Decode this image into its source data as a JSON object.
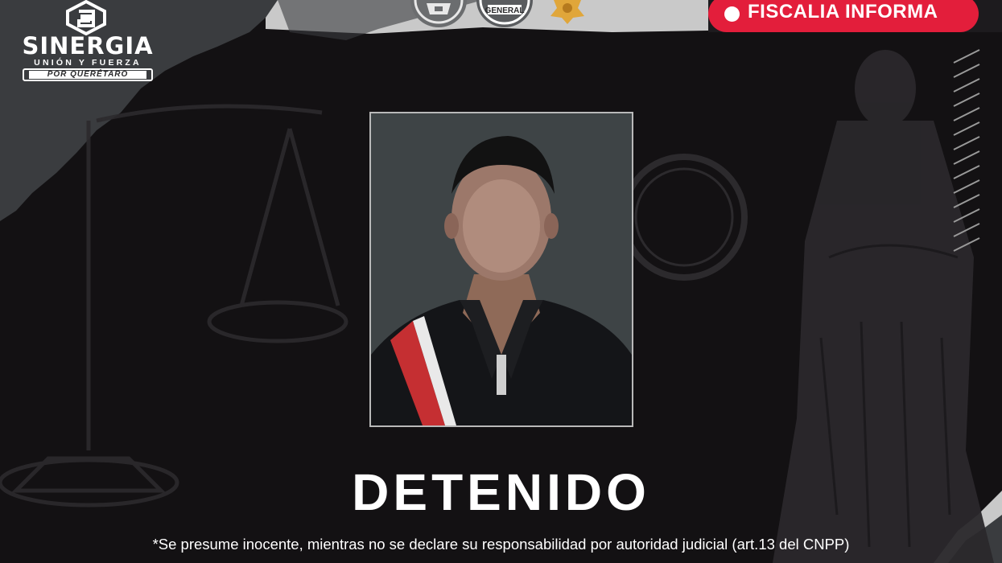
{
  "logo": {
    "name": "SINERGIA",
    "tagline": "UNIÓN Y FUERZA",
    "region": "POR QUERÉTARO"
  },
  "seals": [
    "state-seal-icon",
    "fiscalia-general-seal-icon",
    "police-star-badge-icon"
  ],
  "seal_text": "GENERAL",
  "badge": {
    "label": "FISCALIA INFORMA",
    "color": "#e31e3b"
  },
  "photo": {
    "subject": "person-photo-face-blurred"
  },
  "title": "DETENIDO",
  "disclaimer": "*Se presume inocente, mientras no se declare su responsabilidad por autoridad judicial (art.13 del CNPP)",
  "colors": {
    "background": "#121012",
    "accent": "#e31e3b",
    "gray_banner": "#3a3c3f"
  }
}
